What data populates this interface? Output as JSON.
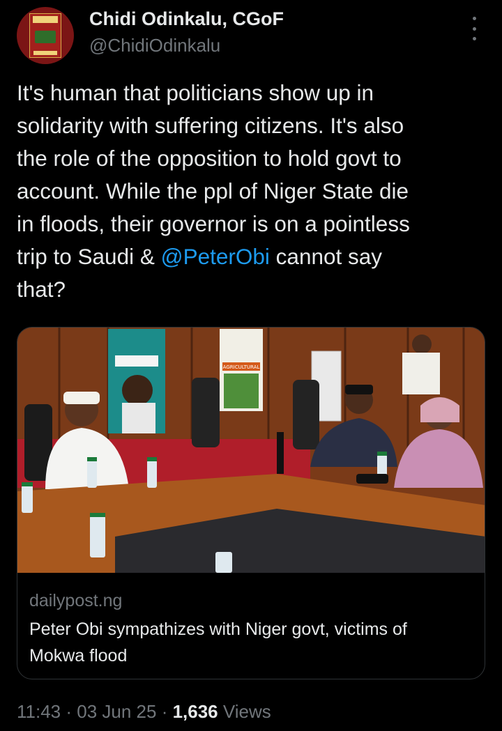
{
  "author": {
    "name": "Chidi Odinkalu, CGoF",
    "handle": "@ChidiOdinkalu",
    "avatar_icon": "book-cover-avatar"
  },
  "tweet": {
    "text_part1": "It's human that politicians show up in\nsolidarity with suffering citizens. It's also\nthe role of the opposition to hold govt to\naccount. While the ppl of Niger State die\nin floods, their governor is on a pointless\ntrip to Saudi & ",
    "mention": "@PeterObi",
    "text_part2": " cannot say\nthat?"
  },
  "card": {
    "source": "dailypost.ng",
    "title": "Peter Obi sympathizes with Niger govt, victims of Mokwa flood",
    "photo_banner_text": "AGRICULTURAL"
  },
  "meta": {
    "time": "11:43",
    "sep1": " · ",
    "date": "03 Jun 25",
    "sep2": " · ",
    "views_count": "1,636",
    "views_label": " Views"
  },
  "icons": {
    "more": "more-vertical-icon"
  },
  "colors": {
    "background": "#000000",
    "text": "#e7e9ea",
    "muted": "#71767b",
    "link": "#1d9bf0",
    "border": "#2f3336"
  }
}
